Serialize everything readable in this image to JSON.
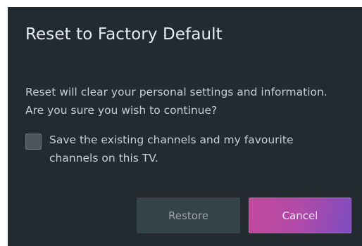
{
  "dialog": {
    "title": "Reset to Factory Default",
    "message_lines": [
      "Reset will clear your personal settings and information.",
      "Are you sure you wish to continue?"
    ],
    "option": {
      "checked": false,
      "label_lines": [
        "Save the existing channels and my favourite",
        "channels on this TV."
      ]
    },
    "buttons": {
      "restore_label": "Restore",
      "cancel_label": "Cancel"
    }
  },
  "colors": {
    "dialog_background": "#232a30",
    "restore_button": "#34424a",
    "cancel_gradient_start": "#c24a9b",
    "cancel_gradient_end": "#7d4cc0"
  }
}
